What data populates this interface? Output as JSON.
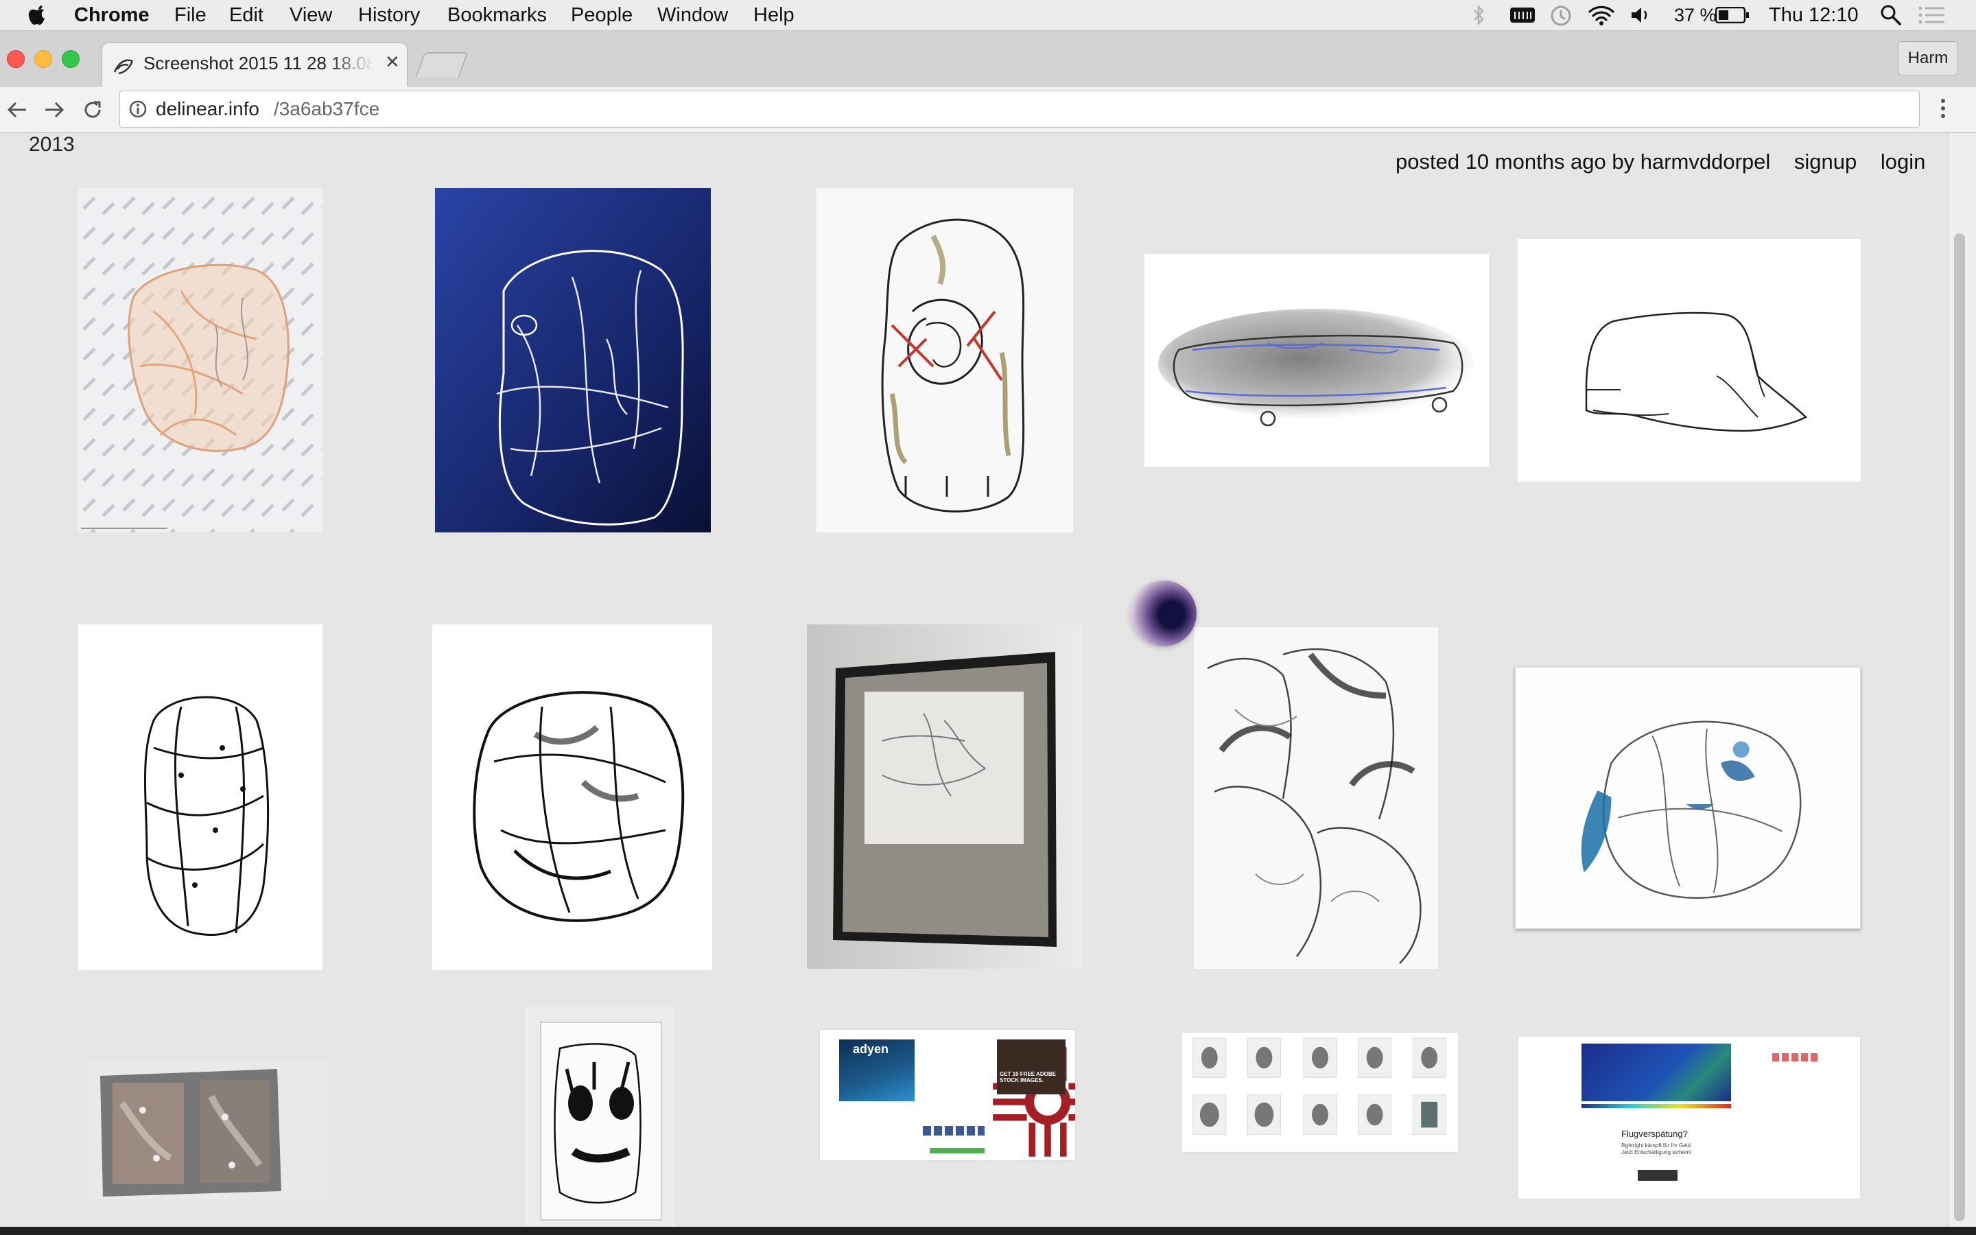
{
  "menubar": {
    "items": [
      "Chrome",
      "File",
      "Edit",
      "View",
      "History",
      "Bookmarks",
      "People",
      "Window",
      "Help"
    ],
    "battery": "37 %",
    "clock": "Thu 12:10"
  },
  "browser": {
    "tab_title": "Screenshot 2015 11 28 18.08",
    "profile": "Harm",
    "url_host": "delinear.info",
    "url_path": "/3a6ab37fce"
  },
  "page": {
    "year": "2013",
    "posted": "posted 10 months ago by harmvddorpel",
    "signup": "signup",
    "login": "login"
  },
  "thumbnails": {
    "adyen_brand": "adyen",
    "adyen_ad_text": "GET 10 FREE ADOBE STOCK IMAGES.",
    "flight_heading": "Flugverspätung?",
    "flight_body": "flightright kämpft für Ihr Geld. Jetzt Entschädigung sichern!"
  },
  "colors": {
    "page_bg": "#e6e6e6",
    "blue_fabric": "#1a2d78",
    "accent_red": "#a51e24"
  }
}
